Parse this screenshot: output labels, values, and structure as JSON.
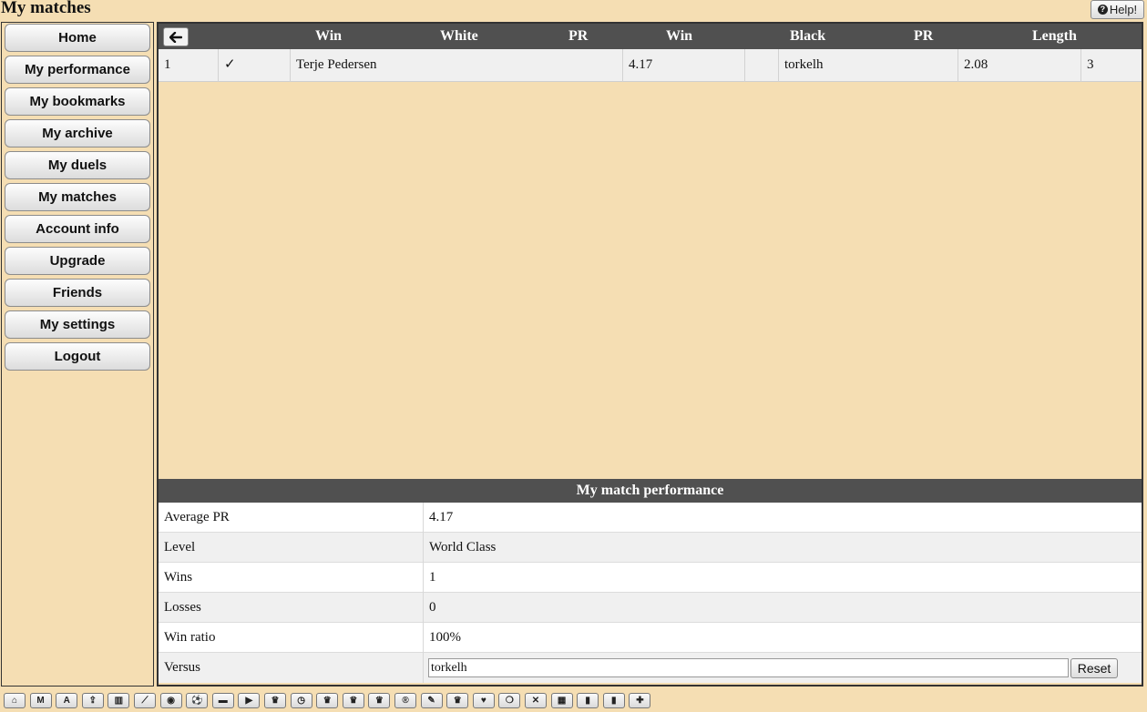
{
  "page": {
    "title": "My matches",
    "help_label": "Help!"
  },
  "sidebar": {
    "items": [
      {
        "label": "Home",
        "name": "nav-home-button"
      },
      {
        "label": "My performance",
        "name": "nav-my-performance-button"
      },
      {
        "label": "My bookmarks",
        "name": "nav-my-bookmarks-button"
      },
      {
        "label": "My archive",
        "name": "nav-my-archive-button"
      },
      {
        "label": "My duels",
        "name": "nav-my-duels-button"
      },
      {
        "label": "My matches",
        "name": "nav-my-matches-button"
      },
      {
        "label": "Account info",
        "name": "nav-account-info-button"
      },
      {
        "label": "Upgrade",
        "name": "nav-upgrade-button"
      },
      {
        "label": "Friends",
        "name": "nav-friends-button"
      },
      {
        "label": "My settings",
        "name": "nav-my-settings-button"
      },
      {
        "label": "Logout",
        "name": "nav-logout-button"
      }
    ]
  },
  "matches": {
    "back_icon": "arrow-left-icon",
    "headers": {
      "win_white": "Win",
      "white": "White",
      "pr_white": "PR",
      "win_black": "Win",
      "black": "Black",
      "pr_black": "PR",
      "length": "Length"
    },
    "rows": [
      {
        "index": "1",
        "white_win": "✓",
        "white": "Terje Pedersen",
        "white_pr": "4.17",
        "black_win": "",
        "black": "torkelh",
        "black_pr": "2.08",
        "length": "3"
      }
    ]
  },
  "performance": {
    "title": "My match performance",
    "rows": [
      {
        "label": "Average PR",
        "value": "4.17"
      },
      {
        "label": "Level",
        "value": "World Class"
      },
      {
        "label": "Wins",
        "value": "1"
      },
      {
        "label": "Losses",
        "value": "0"
      },
      {
        "label": "Win ratio",
        "value": "100%"
      }
    ],
    "versus": {
      "label": "Versus",
      "value": "torkelh",
      "reset_label": "Reset"
    }
  },
  "toolbar": {
    "buttons": [
      {
        "icon": "home-icon",
        "glyph": "⌂"
      },
      {
        "icon": "m-letter-icon",
        "glyph": "M"
      },
      {
        "icon": "a-letter-icon",
        "glyph": "A"
      },
      {
        "icon": "upload-icon",
        "glyph": "⇪"
      },
      {
        "icon": "bar-chart-icon",
        "glyph": "▥"
      },
      {
        "icon": "line-chart-icon",
        "glyph": "⟋"
      },
      {
        "icon": "eye-icon",
        "glyph": "◉"
      },
      {
        "icon": "soccer-ball-icon",
        "glyph": "⚽"
      },
      {
        "icon": "archive-icon",
        "glyph": "▬"
      },
      {
        "icon": "play-icon",
        "glyph": "▶"
      },
      {
        "icon": "trophy-icon",
        "glyph": "♛"
      },
      {
        "icon": "clock-icon",
        "glyph": "◷"
      },
      {
        "icon": "trophy-icon",
        "glyph": "♛"
      },
      {
        "icon": "trophy-icon",
        "glyph": "♛"
      },
      {
        "icon": "trophy-icon",
        "glyph": "♛"
      },
      {
        "icon": "registered-icon",
        "glyph": "®"
      },
      {
        "icon": "edit-icon",
        "glyph": "✎"
      },
      {
        "icon": "trophy-icon",
        "glyph": "♛"
      },
      {
        "icon": "heart-icon",
        "glyph": "♥"
      },
      {
        "icon": "chat-bubbles-icon",
        "glyph": "❍"
      },
      {
        "icon": "close-icon",
        "glyph": "✕"
      },
      {
        "icon": "film-icon",
        "glyph": "▦"
      },
      {
        "icon": "bookmark-icon",
        "glyph": "▮"
      },
      {
        "icon": "bookmark-icon",
        "glyph": "▮"
      },
      {
        "icon": "plus-icon",
        "glyph": "✚"
      }
    ]
  }
}
